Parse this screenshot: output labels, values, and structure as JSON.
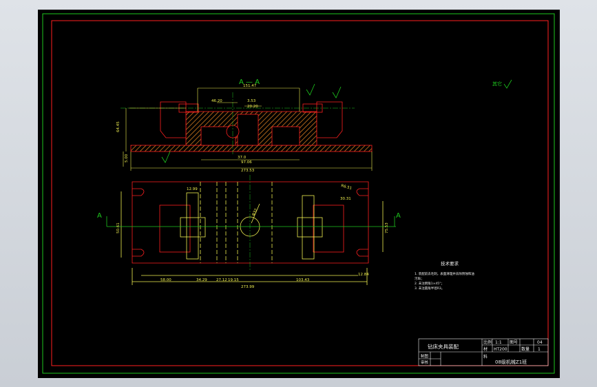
{
  "title": {
    "section": "A — A",
    "roughness_note": "其它",
    "section_mark_left": "A",
    "section_mark_right": "A"
  },
  "dims_top": {
    "width_top": "151.47",
    "d1": "46.20",
    "d2": "3.53",
    "d3": "20.20",
    "height_left": "64.45",
    "height_small": "5.00",
    "base_inner": "97.06",
    "b_mid": "37.0",
    "overall": "273.53"
  },
  "dims_plan": {
    "p1": "12.99",
    "p2": "30.31",
    "dia": "Φ32",
    "corner": "R6.51",
    "left_h": "50.61",
    "right_h": "75.53",
    "b1": "58.00",
    "b2": "34.29",
    "b3": "27.12",
    "b4": "19.15",
    "b5": "103.43",
    "b6": "12.84",
    "overall": "273.99"
  },
  "notes": {
    "heading": "技术要求",
    "lines": [
      "1. 装配前去毛刺，表面清理并去除锈蚀和油",
      "   污垢；",
      "2. 未注倒角1×45°；",
      "3. 未注圆角半径R3。"
    ]
  },
  "title_block": {
    "name": "钻床夹具装配",
    "scale_label": "比例",
    "scale_value": "1:1",
    "sheet_label": "图号",
    "sheet_value": "04",
    "material_label": "材",
    "material_value": "HT200",
    "qty_label": "数量",
    "qty_value": "1",
    "draw_label": "制图",
    "check_label": "审核",
    "part_label": "料",
    "school": "08级机械Z1班"
  },
  "colors": {
    "border_green": "#1ec81e",
    "part_red": "#ff2020",
    "dim_yellow": "#f0f050",
    "hatch_orange": "#d07a20",
    "text_white": "#f2f2f2"
  }
}
